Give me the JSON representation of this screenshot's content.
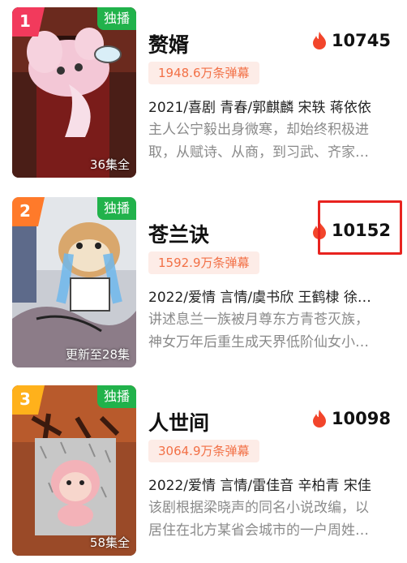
{
  "items": [
    {
      "rank": "1",
      "rank_color": "#f23a5c",
      "exclusive": "独播",
      "episodes": "36集全",
      "title": "赘婿",
      "heat": "10745",
      "danmu": "1948.6万条弹幕",
      "meta": "2021/喜剧 青春/郭麒麟 宋轶 蒋依依",
      "desc_lines": [
        "主人公宁毅出身微寒，却始终积极进",
        "取，从赋诗、从商，到习武、齐家…"
      ]
    },
    {
      "rank": "2",
      "rank_color": "#ff7a2a",
      "exclusive": "独播",
      "episodes": "更新至28集",
      "title": "苍兰诀",
      "heat": "10152",
      "danmu": "1592.9万条弹幕",
      "meta": "2022/爱情 言情/虞书欣 王鹤棣 徐…",
      "desc_lines": [
        "讲述息兰一族被月尊东方青苍灭族，",
        "神女万年后重生成天界低阶仙女小…"
      ]
    },
    {
      "rank": "3",
      "rank_color": "#ffb11b",
      "exclusive": "独播",
      "episodes": "58集全",
      "title": "人世间",
      "heat": "10098",
      "danmu": "3064.9万条弹幕",
      "meta": "2022/爱情 言情/雷佳音 辛柏青 宋佳",
      "desc_lines": [
        "该剧根据梁晓声的同名小说改编，以",
        "居住在北方某省会城市的一户周姓…"
      ]
    }
  ],
  "colors": {
    "exclusive_bg": "#21b24b",
    "danmu_bg": "#fdece7",
    "danmu_text": "#f27046",
    "flame": "#f2452b",
    "highlight": "#e8231f"
  },
  "icons": {
    "heat": "flame-icon"
  }
}
